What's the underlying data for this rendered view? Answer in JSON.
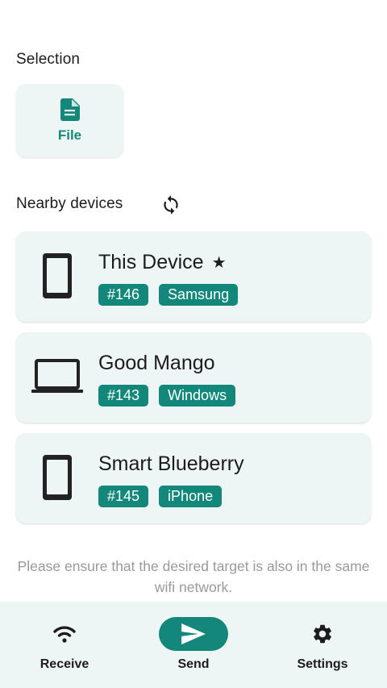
{
  "selection": {
    "title": "Selection",
    "file_label": "File"
  },
  "nearby": {
    "title": "Nearby devices",
    "devices": [
      {
        "name": "This Device",
        "starred": true,
        "icon": "phone-icon",
        "id_tag": "#146",
        "platform": "Samsung"
      },
      {
        "name": "Good Mango",
        "starred": false,
        "icon": "laptop-icon",
        "id_tag": "#143",
        "platform": "Windows"
      },
      {
        "name": "Smart Blueberry",
        "starred": false,
        "icon": "phone-icon",
        "id_tag": "#145",
        "platform": "iPhone"
      }
    ]
  },
  "hint": "Please ensure that the desired target is also in the same wifi network.",
  "nav": {
    "receive": "Receive",
    "send": "Send",
    "settings": "Settings",
    "active": "send"
  },
  "colors": {
    "accent": "#14877b",
    "card_bg": "#eef6f5",
    "hint_text": "#9a9a9a"
  }
}
